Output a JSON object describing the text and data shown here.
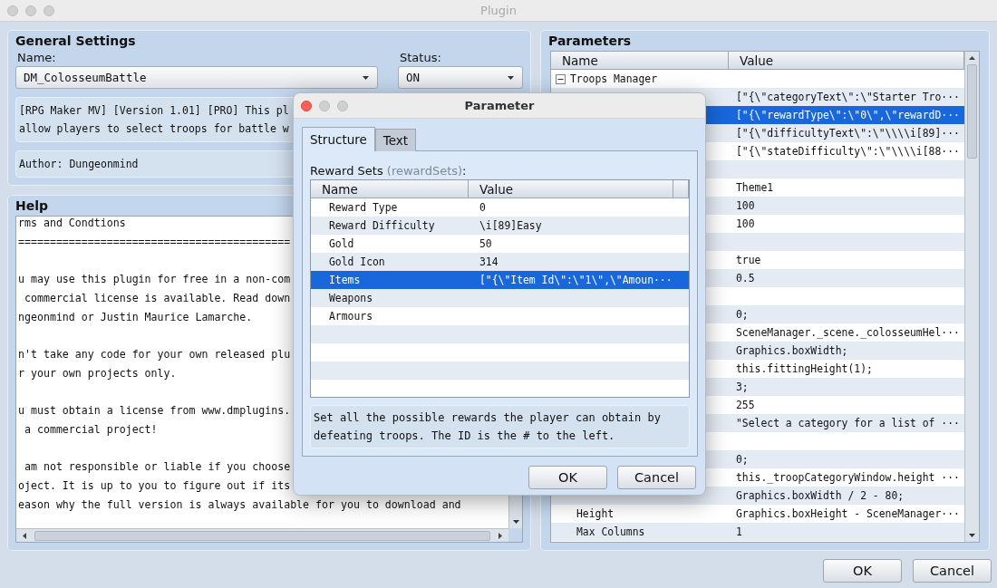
{
  "window": {
    "title": "Plugin"
  },
  "general_settings": {
    "title": "General Settings",
    "name_label": "Name:",
    "name_value": "DM_ColosseumBattle",
    "status_label": "Status:",
    "status_value": "ON",
    "description": [
      "[RPG Maker MV] [Version 1.01] [PRO] This pl",
      "allow players to select troops for battle w"
    ],
    "author": "Author: Dungeonmind"
  },
  "help": {
    "title": "Help",
    "paragraphs": [
      [
        "rms and Condtions",
        "==========================================="
      ],
      [
        "u may use this plugin for free in a non-com",
        " commercial license is available. Read down",
        "ngeonmind or Justin Maurice Lamarche."
      ],
      [
        "n't take any code for your own released plu",
        "r your own projects only."
      ],
      [
        "u must obtain a license from www.dmplugins.",
        " a commercial project!"
      ],
      [
        " am not responsible or liable if you choose",
        "oject. It is up to you to figure out if its",
        "eason why the full version is always available for you to download and"
      ]
    ]
  },
  "parameters": {
    "title": "Parameters",
    "columns": [
      "Name",
      "Value"
    ],
    "rows": [
      {
        "name": "Troops Manager",
        "expanded": true,
        "selected": false,
        "children": [
          {
            "value": "[\"{\\\"categoryText\\\":\\\"Starter Tro···",
            "selected": false
          },
          {
            "value": "[\"{\\\"rewardType\\\":\\\"0\\\",\\\"rewardD···",
            "selected": true
          },
          {
            "value": "[\"{\\\"difficultyText\\\":\\\"\\\\\\\\i[89]···",
            "selected": false
          },
          {
            "value": "[\"{\\\"stateDifficulty\\\":\\\"\\\\\\\\i[88···",
            "selected": false
          },
          {
            "selected": false
          },
          {
            "value": "Theme1",
            "selected": false
          },
          {
            "value": "100",
            "selected": false
          },
          {
            "value": "100",
            "selected": false
          },
          {
            "selected": false
          },
          {
            "value": "true",
            "selected": false
          },
          {
            "value": "0.5",
            "selected": false
          },
          {
            "selected": false
          },
          {
            "value": "0;",
            "selected": false
          },
          {
            "value": "SceneManager._scene._colosseumHel···",
            "selected": false
          },
          {
            "value": "Graphics.boxWidth;",
            "selected": false
          },
          {
            "value": "this.fittingHeight(1);",
            "selected": false
          },
          {
            "value": "3;",
            "selected": false
          },
          {
            "value": "255",
            "selected": false
          },
          {
            "value": "\"Select a category for a list of ···",
            "selected": false
          },
          {
            "selected": false
          },
          {
            "value": "0;",
            "selected": false
          },
          {
            "value": "this._troopCategoryWindow.height ···",
            "selected": false
          },
          {
            "value": "Graphics.boxWidth / 2 - 80;",
            "selected": false
          },
          {
            "name": "Height",
            "value": "Graphics.boxHeight - SceneManager···",
            "selected": false
          },
          {
            "name": "Max Columns",
            "value": "1",
            "selected": false
          }
        ]
      }
    ]
  },
  "buttons": [
    "OK",
    "Cancel"
  ],
  "dialog": {
    "title": "Parameter",
    "tabs": [
      {
        "label": "Structure",
        "selected": true
      },
      {
        "label": "Text",
        "selected": false
      }
    ],
    "field": {
      "label": "Reward Sets",
      "key": "(rewardSets)",
      "suffix": ":"
    },
    "columns": [
      "Name",
      "Value"
    ],
    "rows": [
      {
        "name": "Reward Type",
        "value": "0",
        "selected": false
      },
      {
        "name": "Reward Difficulty",
        "value": "\\i[89]Easy",
        "selected": false
      },
      {
        "name": "Gold",
        "value": "50",
        "selected": false
      },
      {
        "name": "Gold Icon",
        "value": "314",
        "selected": false
      },
      {
        "name": "Items",
        "value": "[\"{\\\"Item Id\\\":\\\"1\\\",\\\"Amoun···",
        "selected": true
      },
      {
        "name": "Weapons",
        "selected": false
      },
      {
        "name": "Armours",
        "selected": false
      }
    ],
    "description": "Set all the possible rewards the player can obtain by defeating troops. The ID is the # to the left.",
    "buttons": [
      "OK",
      "Cancel"
    ]
  }
}
